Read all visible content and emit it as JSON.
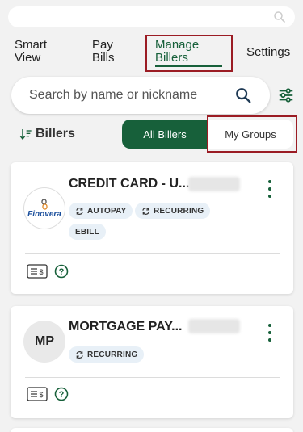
{
  "nav": {
    "tabs": [
      {
        "label": "Smart View"
      },
      {
        "label": "Pay Bills"
      },
      {
        "label": "Manage Billers"
      },
      {
        "label": "Settings"
      }
    ]
  },
  "search": {
    "placeholder": "Search by name or nickname"
  },
  "list": {
    "heading": "Billers",
    "segments": [
      {
        "label": "All Billers"
      },
      {
        "label": "My Groups"
      }
    ]
  },
  "billers": [
    {
      "name": "CREDIT CARD - U...",
      "logo_text": "Finovera",
      "tags": [
        "AUTOPAY",
        "RECURRING",
        "EBILL"
      ]
    },
    {
      "name": "MORTGAGE PAY...",
      "initials": "MP",
      "tags": [
        "RECURRING"
      ]
    }
  ],
  "colors": {
    "accent": "#17603a",
    "highlight": "#9b1c24",
    "chip_bg": "#e8f0f7"
  }
}
